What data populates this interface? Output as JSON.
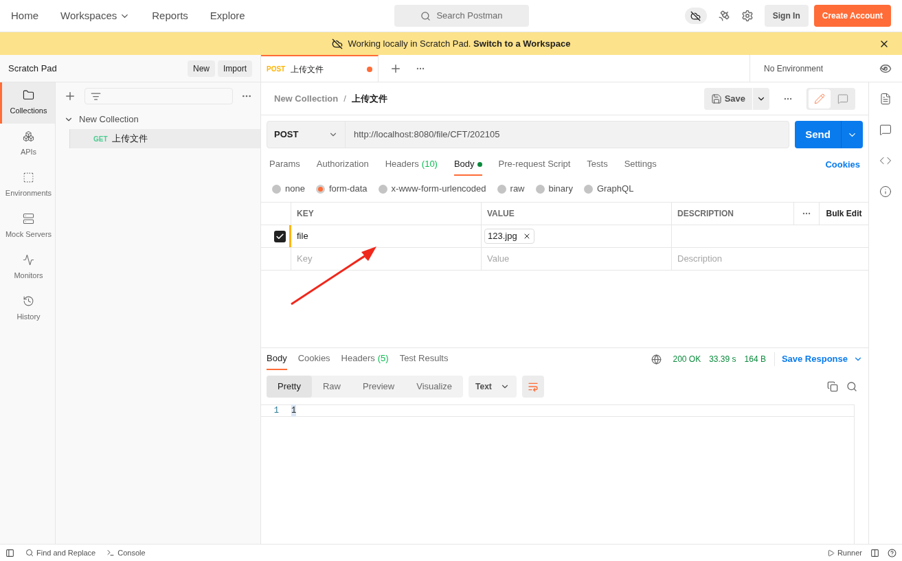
{
  "top_nav": {
    "items": [
      {
        "label": "Home",
        "dropdown": false
      },
      {
        "label": "Workspaces",
        "dropdown": true
      },
      {
        "label": "Reports",
        "dropdown": false
      },
      {
        "label": "Explore",
        "dropdown": false
      }
    ],
    "search": {
      "placeholder": "Search Postman"
    },
    "sign_in": "Sign In",
    "create_account": "Create Account"
  },
  "banner": {
    "text": "Working locally in Scratch Pad. **Switch to a Workspace**"
  },
  "sidebar": {
    "title": "Scratch Pad",
    "buttons": [
      "New",
      "Import"
    ],
    "nav": [
      {
        "label": "Collections",
        "selected": true
      },
      {
        "label": "APIs",
        "selected": false
      },
      {
        "label": "Environments",
        "selected": false
      },
      {
        "label": "Mock Servers",
        "selected": false
      },
      {
        "label": "Monitors",
        "selected": false
      },
      {
        "label": "History",
        "selected": false
      }
    ],
    "collections": [
      {
        "name": "New Collection",
        "expanded": true,
        "children": [
          {
            "method": "GET",
            "color": "#49cc90",
            "name": "上传文件",
            "selected": true
          }
        ]
      }
    ]
  },
  "tabs": [
    {
      "method": "POST",
      "color": "#ffb400",
      "name": "上传文件",
      "unsaved": true,
      "selected": true
    }
  ],
  "environment": "No Environment",
  "breadcrumb": [
    "New Collection",
    "/",
    "上传文件"
  ],
  "save": "Save",
  "request": {
    "method": "POST",
    "url": "http://localhost:8080/file/CFT/202105",
    "send": "Send"
  },
  "request_tabs": [
    {
      "label": "Params",
      "selected": false
    },
    {
      "label": "Authorization",
      "selected": false
    },
    {
      "label": "Headers",
      "count": "(10)",
      "selected": false
    },
    {
      "label": "Body",
      "dot": true,
      "selected": true
    },
    {
      "label": "Pre-request Script",
      "selected": false
    },
    {
      "label": "Tests",
      "selected": false
    },
    {
      "label": "Settings",
      "selected": false
    }
  ],
  "cookies": "Cookies",
  "body_types": [
    {
      "label": "none",
      "selected": false
    },
    {
      "label": "form-data",
      "selected": true
    },
    {
      "label": "x-www-form-urlencoded",
      "selected": false
    },
    {
      "label": "raw",
      "selected": false
    },
    {
      "label": "binary",
      "selected": false
    },
    {
      "label": "GraphQL",
      "selected": false
    }
  ],
  "params_table": {
    "columns": [
      "KEY",
      "VALUE",
      "DESCRIPTION"
    ],
    "bulk_edit": "Bulk Edit",
    "rows": [
      {
        "checked": true,
        "key": "file",
        "file": "123.jpg"
      }
    ],
    "placeholder_row": {
      "key": "Key",
      "value": "Value",
      "description": "Description"
    }
  },
  "response": {
    "tabs": [
      {
        "label": "Body",
        "selected": true
      },
      {
        "label": "Cookies",
        "selected": false
      },
      {
        "label": "Headers",
        "count": "(5)",
        "selected": false
      },
      {
        "label": "Test Results",
        "selected": false
      }
    ],
    "status": "200 OK",
    "time": "33.39 s",
    "size": "164 B",
    "save_response": "Save Response",
    "view_modes": [
      {
        "label": "Pretty",
        "selected": true
      },
      {
        "label": "Raw",
        "selected": false
      },
      {
        "label": "Preview",
        "selected": false
      },
      {
        "label": "Visualize",
        "selected": false
      }
    ],
    "format": "Text",
    "lines": [
      {
        "number": "1",
        "text": "1"
      }
    ]
  },
  "status_bar": {
    "left": [
      "Find and Replace",
      "Console"
    ],
    "right": [
      "Runner"
    ]
  }
}
